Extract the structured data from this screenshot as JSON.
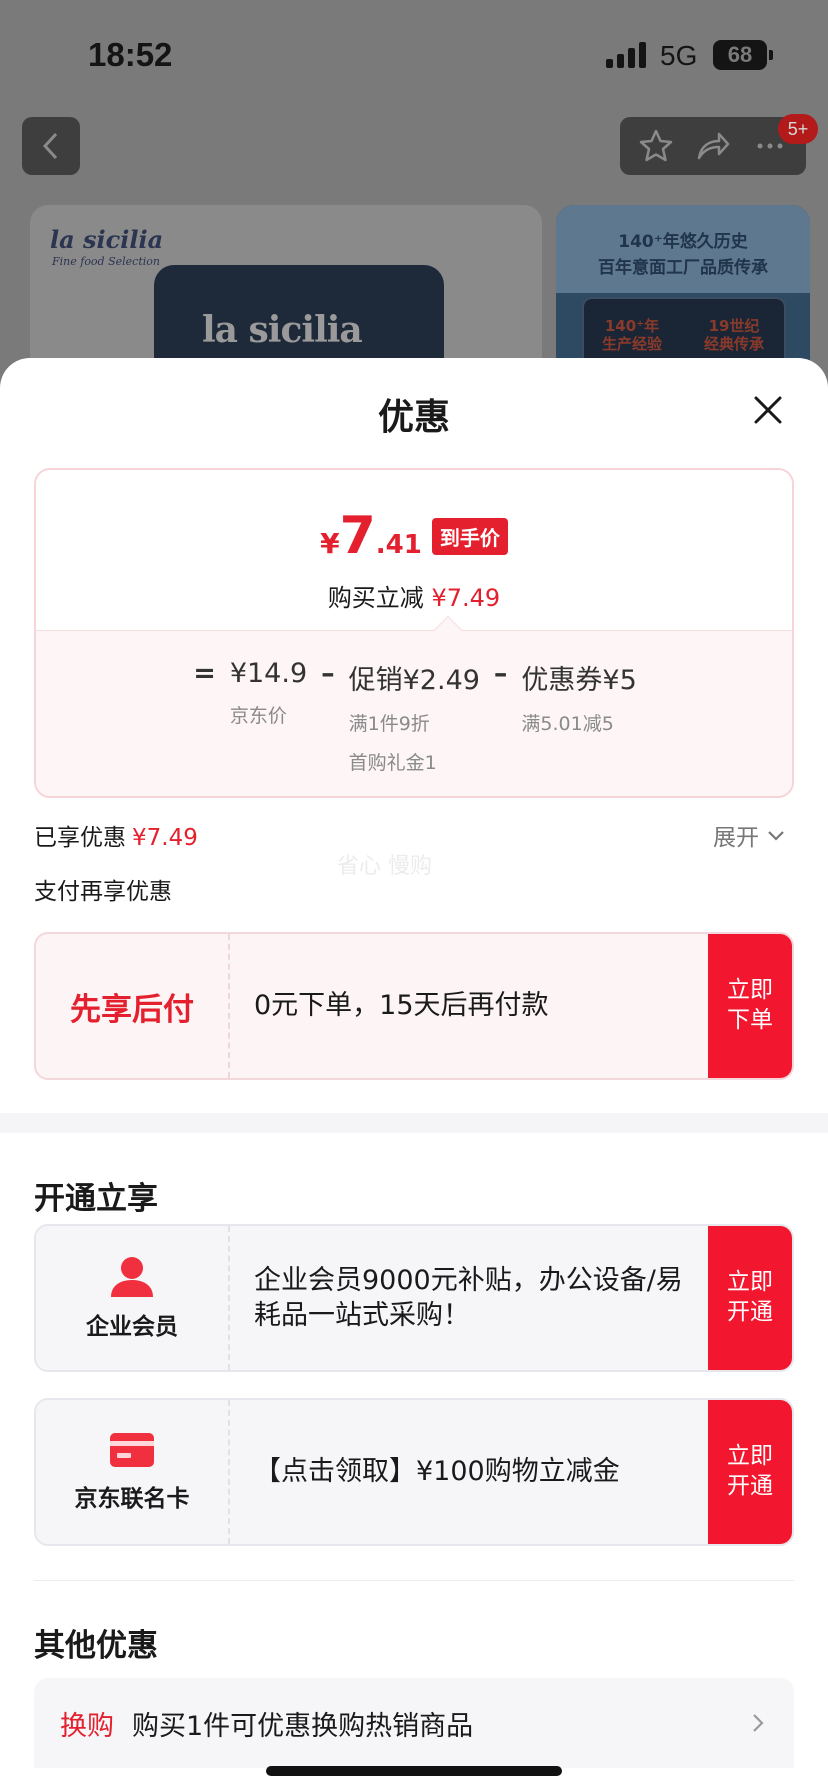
{
  "status_bar": {
    "time": "18:52",
    "network": "5G",
    "battery": "68"
  },
  "nav": {
    "badge": "5+"
  },
  "product": {
    "brand": "la sicilia",
    "brand_sub": "Fine food Selection",
    "pack_name": "la sicilia",
    "banner_line1": "140⁺年悠久历史",
    "banner_line2": "百年意面工厂品质传承",
    "banner_stat1": "140⁺年\n生产经验",
    "banner_stat2": "19世纪\n经典传承"
  },
  "sheet": {
    "title": "优惠",
    "price": {
      "yen": "¥",
      "integer": "7",
      "decimal": ".41",
      "tag": "到手价",
      "reduce_label": "购买立减",
      "reduce_amount": "¥7.49"
    },
    "formula": {
      "eq": "=",
      "jd_price": "¥14.9",
      "jd_label": "京东价",
      "minus1": "–",
      "promo": "促销¥2.49",
      "promo_sub1": "满1件9折",
      "promo_sub2": "首购礼金1",
      "minus2": "–",
      "coupon": "优惠券¥5",
      "coupon_sub": "满5.01减5"
    },
    "enjoyed_label": "已享优惠",
    "enjoyed_amount": "¥7.49",
    "expand": "展开",
    "watermark": "省心 慢购",
    "pay_label": "支付再享优惠",
    "bnpl": {
      "title": "先享后付",
      "desc": "0元下单，15天后再付款",
      "button": "立即下单"
    },
    "open_section": "开通立享",
    "enterprise": {
      "label": "企业会员",
      "desc": "企业会员9000元补贴，办公设备/易耗品一站式采购！",
      "button": "立即开通"
    },
    "card": {
      "label": "京东联名卡",
      "desc": "【点击领取】¥100购物立减金",
      "button": "立即开通"
    },
    "other_section": "其他优惠",
    "other_item": {
      "tag": "换购",
      "text": "购买1件可优惠换购热销商品"
    }
  },
  "colors": {
    "accent": "#e4202e",
    "button": "#f2172e"
  }
}
